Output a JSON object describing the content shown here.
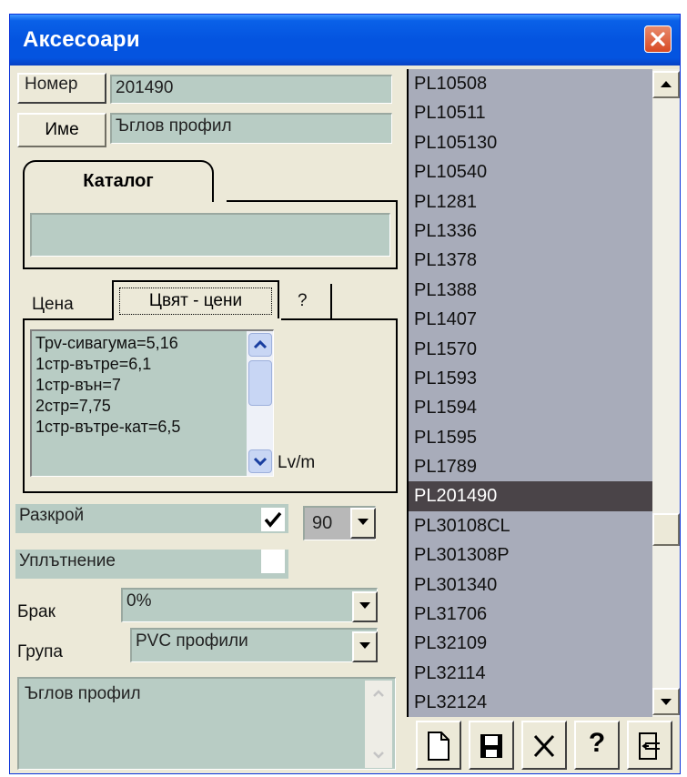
{
  "window": {
    "title": "Аксесоари"
  },
  "header": {
    "number_label": "Номер",
    "number_value": "201490",
    "name_button": "Име",
    "name_value": "Ъглов профил"
  },
  "catalog": {
    "tab_label": "Каталог",
    "value": ""
  },
  "price_tabs": {
    "tabs": [
      "Цена",
      "Цвят - цени",
      "?"
    ],
    "lines": [
      "Трv-сивагума=5,16",
      "1стр-вътре=6,1",
      "1стр-вън=7",
      "2стр=7,75",
      "1стр-вътре-кат=6,5"
    ],
    "unit": "Lv/m"
  },
  "cut": {
    "label": "Разкрой",
    "checked": true,
    "angle": "90"
  },
  "seal": {
    "label": "Уплътнение",
    "checked": false
  },
  "defect": {
    "label": "Брак",
    "value": "0%"
  },
  "group": {
    "label": "Група",
    "value": "PVC профили"
  },
  "description": "Ъглов профил",
  "list": {
    "items": [
      "PL10508",
      "PL10511",
      "PL105130",
      "PL10540",
      "PL1281",
      "PL1336",
      "PL1378",
      "PL1388",
      "PL1407",
      "PL1570",
      "PL1593",
      "PL1594",
      "PL1595",
      "PL1789",
      "PL201490",
      "PL30108CL",
      "PL301308P",
      "PL301340",
      "PL31706",
      "PL32109",
      "PL32114",
      "PL32124"
    ],
    "selected": "PL201490"
  },
  "toolbar": {
    "icons": [
      "new-document-icon",
      "save-icon",
      "delete-icon",
      "help-icon",
      "exit-icon"
    ],
    "help_glyph": "?"
  },
  "colors": {
    "title_bar": "#0454e0",
    "field_bg": "#b8ccc4",
    "list_bg": "#a8acba",
    "list_selected": "#4a4448",
    "window_bg": "#ece9d8"
  }
}
